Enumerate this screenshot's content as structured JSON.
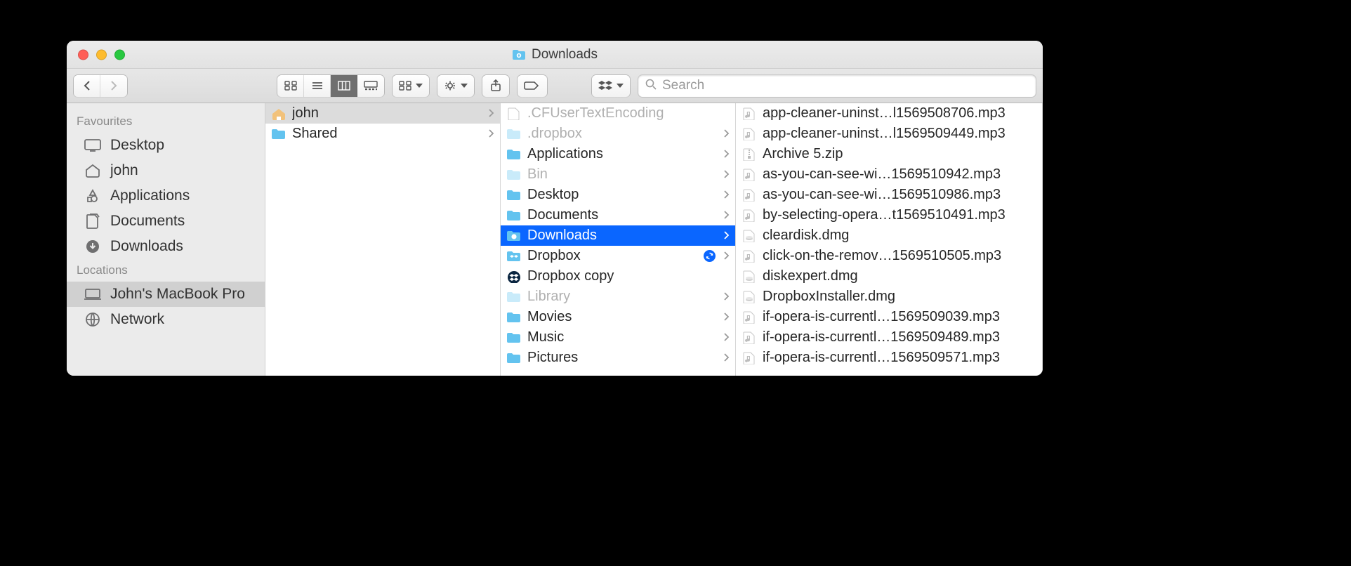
{
  "title": "Downloads",
  "search": {
    "placeholder": "Search"
  },
  "sidebar": {
    "sections": [
      {
        "header": "Favourites",
        "items": [
          {
            "label": "Desktop",
            "icon": "desktop"
          },
          {
            "label": "john",
            "icon": "home"
          },
          {
            "label": "Applications",
            "icon": "apps"
          },
          {
            "label": "Documents",
            "icon": "docs"
          },
          {
            "label": "Downloads",
            "icon": "downloads"
          }
        ]
      },
      {
        "header": "Locations",
        "items": [
          {
            "label": "John's MacBook Pro",
            "icon": "laptop",
            "selected": true
          },
          {
            "label": "Network",
            "icon": "network"
          }
        ]
      }
    ]
  },
  "col1": [
    {
      "label": "john",
      "icon": "home-color",
      "selected": true,
      "arrow": true
    },
    {
      "label": "Shared",
      "icon": "folder",
      "arrow": true
    }
  ],
  "col2": [
    {
      "label": ".CFUserTextEncoding",
      "icon": "blankfile",
      "hidden": true
    },
    {
      "label": ".dropbox",
      "icon": "folder-hidden",
      "hidden": true,
      "arrow": true
    },
    {
      "label": "Applications",
      "icon": "folder",
      "arrow": true
    },
    {
      "label": "Bin",
      "icon": "folder-hidden",
      "hidden": true,
      "arrow": true
    },
    {
      "label": "Desktop",
      "icon": "folder",
      "arrow": true
    },
    {
      "label": "Documents",
      "icon": "folder",
      "arrow": true
    },
    {
      "label": "Downloads",
      "icon": "folder-dl",
      "selected": true,
      "arrow": true
    },
    {
      "label": "Dropbox",
      "icon": "folder-dropbox",
      "arrow": true,
      "sync": true
    },
    {
      "label": "Dropbox copy",
      "icon": "dropbox-app"
    },
    {
      "label": "Library",
      "icon": "folder-hidden",
      "hidden": true,
      "arrow": true
    },
    {
      "label": "Movies",
      "icon": "folder",
      "arrow": true
    },
    {
      "label": "Music",
      "icon": "folder",
      "arrow": true
    },
    {
      "label": "Pictures",
      "icon": "folder",
      "arrow": true
    }
  ],
  "col3": [
    {
      "left": "app-cleaner-uninst…l",
      "right": "1569508706.mp3",
      "icon": "audio"
    },
    {
      "left": "app-cleaner-uninst…l",
      "right": "1569509449.mp3",
      "icon": "audio"
    },
    {
      "left": "Archive 5.zip",
      "right": "",
      "icon": "zip"
    },
    {
      "left": "as-you-can-see-wi…",
      "right": "1569510942.mp3",
      "icon": "audio"
    },
    {
      "left": "as-you-can-see-wi…",
      "right": "1569510986.mp3",
      "icon": "audio"
    },
    {
      "left": "by-selecting-opera…t",
      "right": "1569510491.mp3",
      "icon": "audio"
    },
    {
      "left": "cleardisk.dmg",
      "right": "",
      "icon": "dmg"
    },
    {
      "left": "click-on-the-remov…",
      "right": "1569510505.mp3",
      "icon": "audio"
    },
    {
      "left": "diskexpert.dmg",
      "right": "",
      "icon": "dmg"
    },
    {
      "left": "DropboxInstaller.dmg",
      "right": "",
      "icon": "dmg"
    },
    {
      "left": "if-opera-is-currentl…",
      "right": "1569509039.mp3",
      "icon": "audio"
    },
    {
      "left": "if-opera-is-currentl…",
      "right": "1569509489.mp3",
      "icon": "audio"
    },
    {
      "left": "if-opera-is-currentl…",
      "right": "1569509571.mp3",
      "icon": "audio"
    }
  ]
}
